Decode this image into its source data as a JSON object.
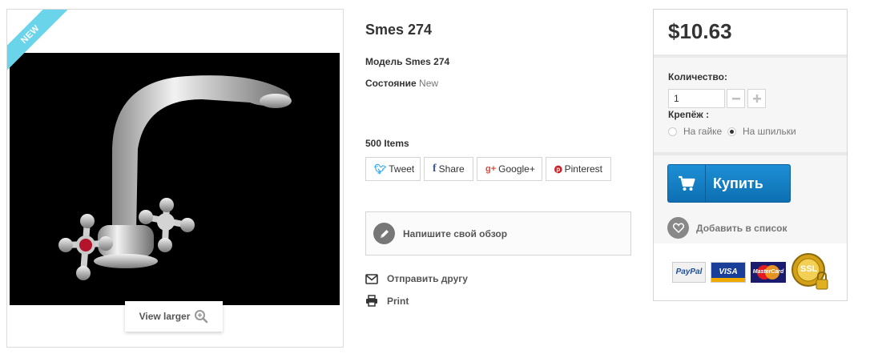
{
  "badge": {
    "label": "NEW"
  },
  "image_panel": {
    "view_larger_label": "View larger"
  },
  "product": {
    "title": "Smes 274",
    "model_label": "Модель",
    "model_value": "Smes 274",
    "condition_label": "Состояние",
    "condition_value": "New",
    "items_count": "500 Items"
  },
  "share": {
    "tweet": "Tweet",
    "share": "Share",
    "google": "Google+",
    "pinterest": "Pinterest"
  },
  "review": {
    "label": "Напишите свой обзор"
  },
  "links": {
    "send_to_friend": "Отправить другу",
    "print": "Print"
  },
  "buy_box": {
    "price": "$10.63",
    "quantity_label": "Количество:",
    "quantity_value": "1",
    "attribute_label": "Крепёж :",
    "options": [
      {
        "label": "На гайке",
        "checked": false
      },
      {
        "label": "На шпильки",
        "checked": true
      }
    ],
    "buy_label": "Купить",
    "wishlist_label": "Добавить в список"
  },
  "payment": {
    "paypal": "PayPal",
    "visa": "VISA",
    "mastercard": "MasterCard",
    "ssl": "SSL"
  },
  "colors": {
    "accent": "#1e8fd6",
    "badge": "#6ad4ea",
    "photo_background": "#000000"
  }
}
